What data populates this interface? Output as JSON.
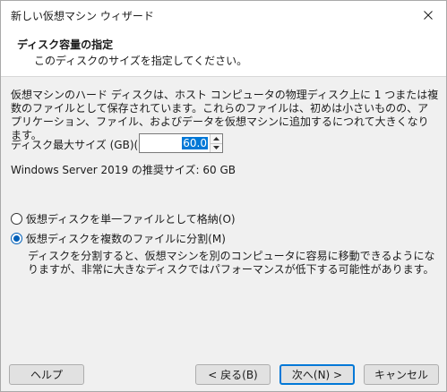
{
  "window": {
    "title": "新しい仮想マシン ウィザード"
  },
  "header": {
    "title": "ディスク容量の指定",
    "subtitle": "このディスクのサイズを指定してください。"
  },
  "content": {
    "description": "仮想マシンのハード ディスクは、ホスト コンピュータの物理ディスク上に 1 つまたは複数のファイルとして保存されています。これらのファイルは、初めは小さいものの、アプリケーション、ファイル、およびデータを仮想マシンに追加するにつれて大きくなります。",
    "disk_size_label": "ディスク最大サイズ (GB)(S):",
    "disk_size_value": "60.0",
    "recommended": "Windows Server 2019 の推奨サイズ: 60 GB",
    "radio_single": "仮想ディスクを単一ファイルとして格納(O)",
    "radio_single_checked": false,
    "radio_split": "仮想ディスクを複数のファイルに分割(M)",
    "radio_split_checked": true,
    "split_description": "ディスクを分割すると、仮想マシンを別のコンピュータに容易に移動できるようになりますが、非常に大きなディスクではパフォーマンスが低下する可能性があります。"
  },
  "footer": {
    "help": "ヘルプ",
    "back": "< 戻る(B)",
    "next": "次へ(N) >",
    "cancel": "キャンセル"
  },
  "icons": {
    "close": "close-icon",
    "spin_up": "spin-up-icon",
    "spin_down": "spin-down-icon"
  },
  "colors": {
    "accent": "#0078d7",
    "radio_selected": "#005fb8",
    "header_bg": "#ffffff",
    "body_bg": "#f0f0f0"
  }
}
